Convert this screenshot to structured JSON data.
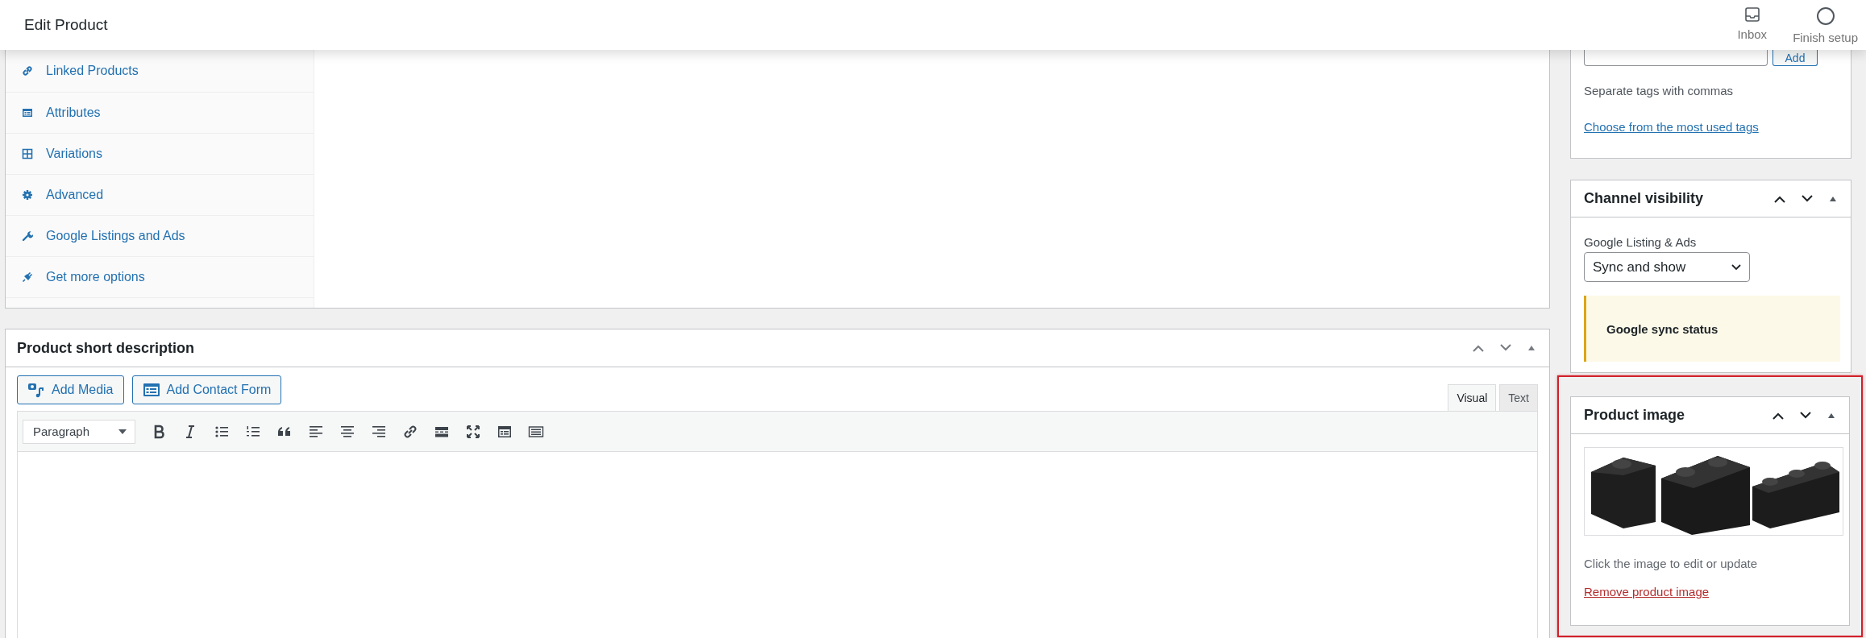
{
  "header": {
    "title": "Edit Product",
    "actions": [
      {
        "label": "Inbox",
        "kind": "inbox"
      },
      {
        "label": "Finish setup",
        "kind": "progress"
      }
    ]
  },
  "product_data": {
    "tabs": [
      {
        "label": "Linked Products",
        "kind": "link"
      },
      {
        "label": "Attributes",
        "kind": "attributes"
      },
      {
        "label": "Variations",
        "kind": "grid"
      },
      {
        "label": "Advanced",
        "kind": "gear"
      },
      {
        "label": "Google Listings and Ads",
        "kind": "wrench"
      },
      {
        "label": "Get more options",
        "kind": "plug"
      }
    ]
  },
  "short_description": {
    "title": "Product short description",
    "media_buttons": [
      {
        "label": "Add Media",
        "kind": "media"
      },
      {
        "label": "Add Contact Form",
        "kind": "form"
      }
    ],
    "editor_tabs": [
      {
        "label": "Visual",
        "selected": true
      },
      {
        "label": "Text",
        "selected": false
      }
    ],
    "format_select": "Paragraph"
  },
  "tags": {
    "button": "Add",
    "hint": "Separate tags with commas",
    "link": "Choose from the most used tags"
  },
  "channel_visibility": {
    "title": "Channel visibility",
    "field_label": "Google Listing & Ads",
    "select_value": "Sync and show",
    "notice": "Google sync status"
  },
  "product_image": {
    "title": "Product image",
    "highlighted": true,
    "hint": "Click the image to edit or update",
    "link": "Remove product image"
  }
}
